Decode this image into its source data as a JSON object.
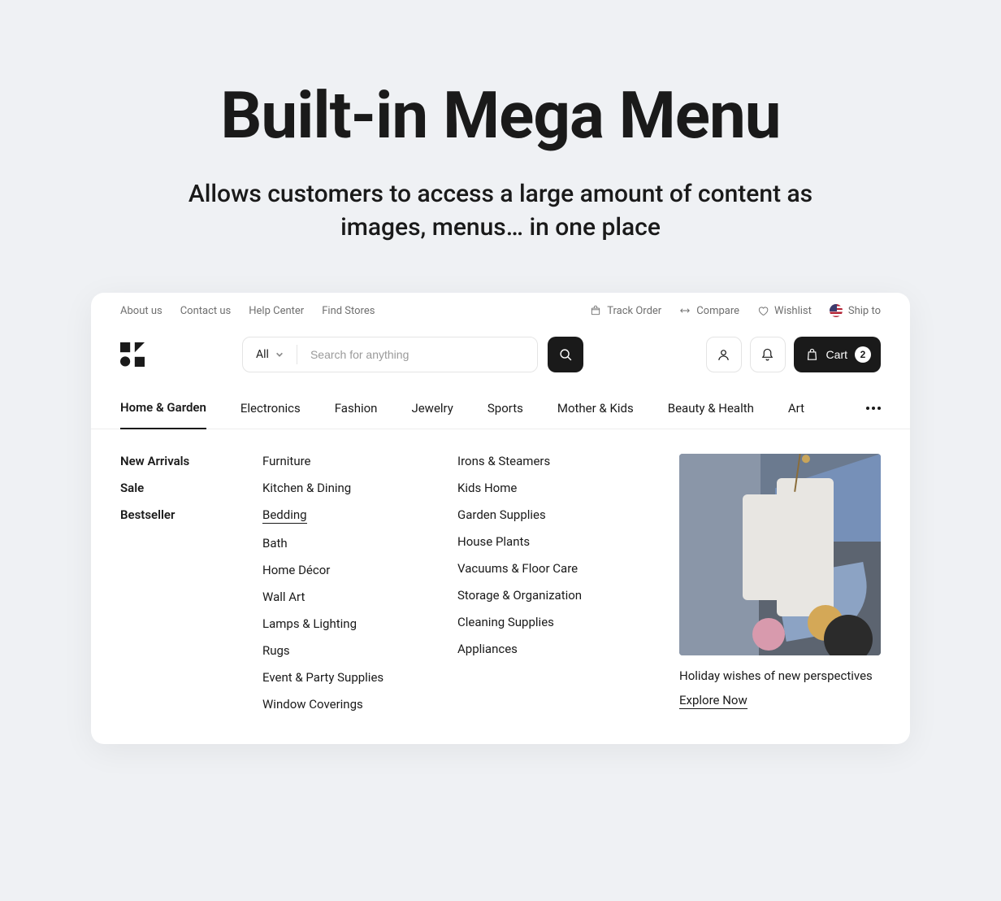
{
  "hero": {
    "title": "Built-in Mega Menu",
    "subtitle": "Allows customers to access a large amount of content as images, menus… in one place"
  },
  "topbar": {
    "left": [
      "About us",
      "Contact us",
      "Help Center",
      "Find Stores"
    ],
    "right": [
      {
        "icon": "package",
        "label": "Track Order"
      },
      {
        "icon": "compare",
        "label": "Compare"
      },
      {
        "icon": "heart",
        "label": "Wishlist"
      },
      {
        "icon": "flag",
        "label": "Ship to"
      }
    ]
  },
  "search": {
    "category": "All",
    "placeholder": "Search for anything"
  },
  "cart": {
    "label": "Cart",
    "count": "2"
  },
  "categories": [
    "Home & Garden",
    "Electronics",
    "Fashion",
    "Jewelry",
    "Sports",
    "Mother & Kids",
    "Beauty & Health",
    "Art"
  ],
  "active_category": 0,
  "mega": {
    "col1": [
      "New Arrivals",
      "Sale",
      "Bestseller"
    ],
    "col2": [
      "Furniture",
      "Kitchen & Dining",
      "Bedding",
      "Bath",
      "Home Décor",
      "Wall Art",
      "Lamps & Lighting",
      "Rugs",
      "Event & Party Supplies",
      "Window Coverings"
    ],
    "col2_highlighted": 2,
    "col3": [
      "Irons & Steamers",
      "Kids Home",
      "Garden Supplies",
      "House Plants",
      "Vacuums & Floor Care",
      "Storage & Organization",
      "Cleaning Supplies",
      "Appliances"
    ],
    "promo": {
      "caption": "Holiday wishes of new perspectives",
      "cta": "Explore Now"
    }
  }
}
